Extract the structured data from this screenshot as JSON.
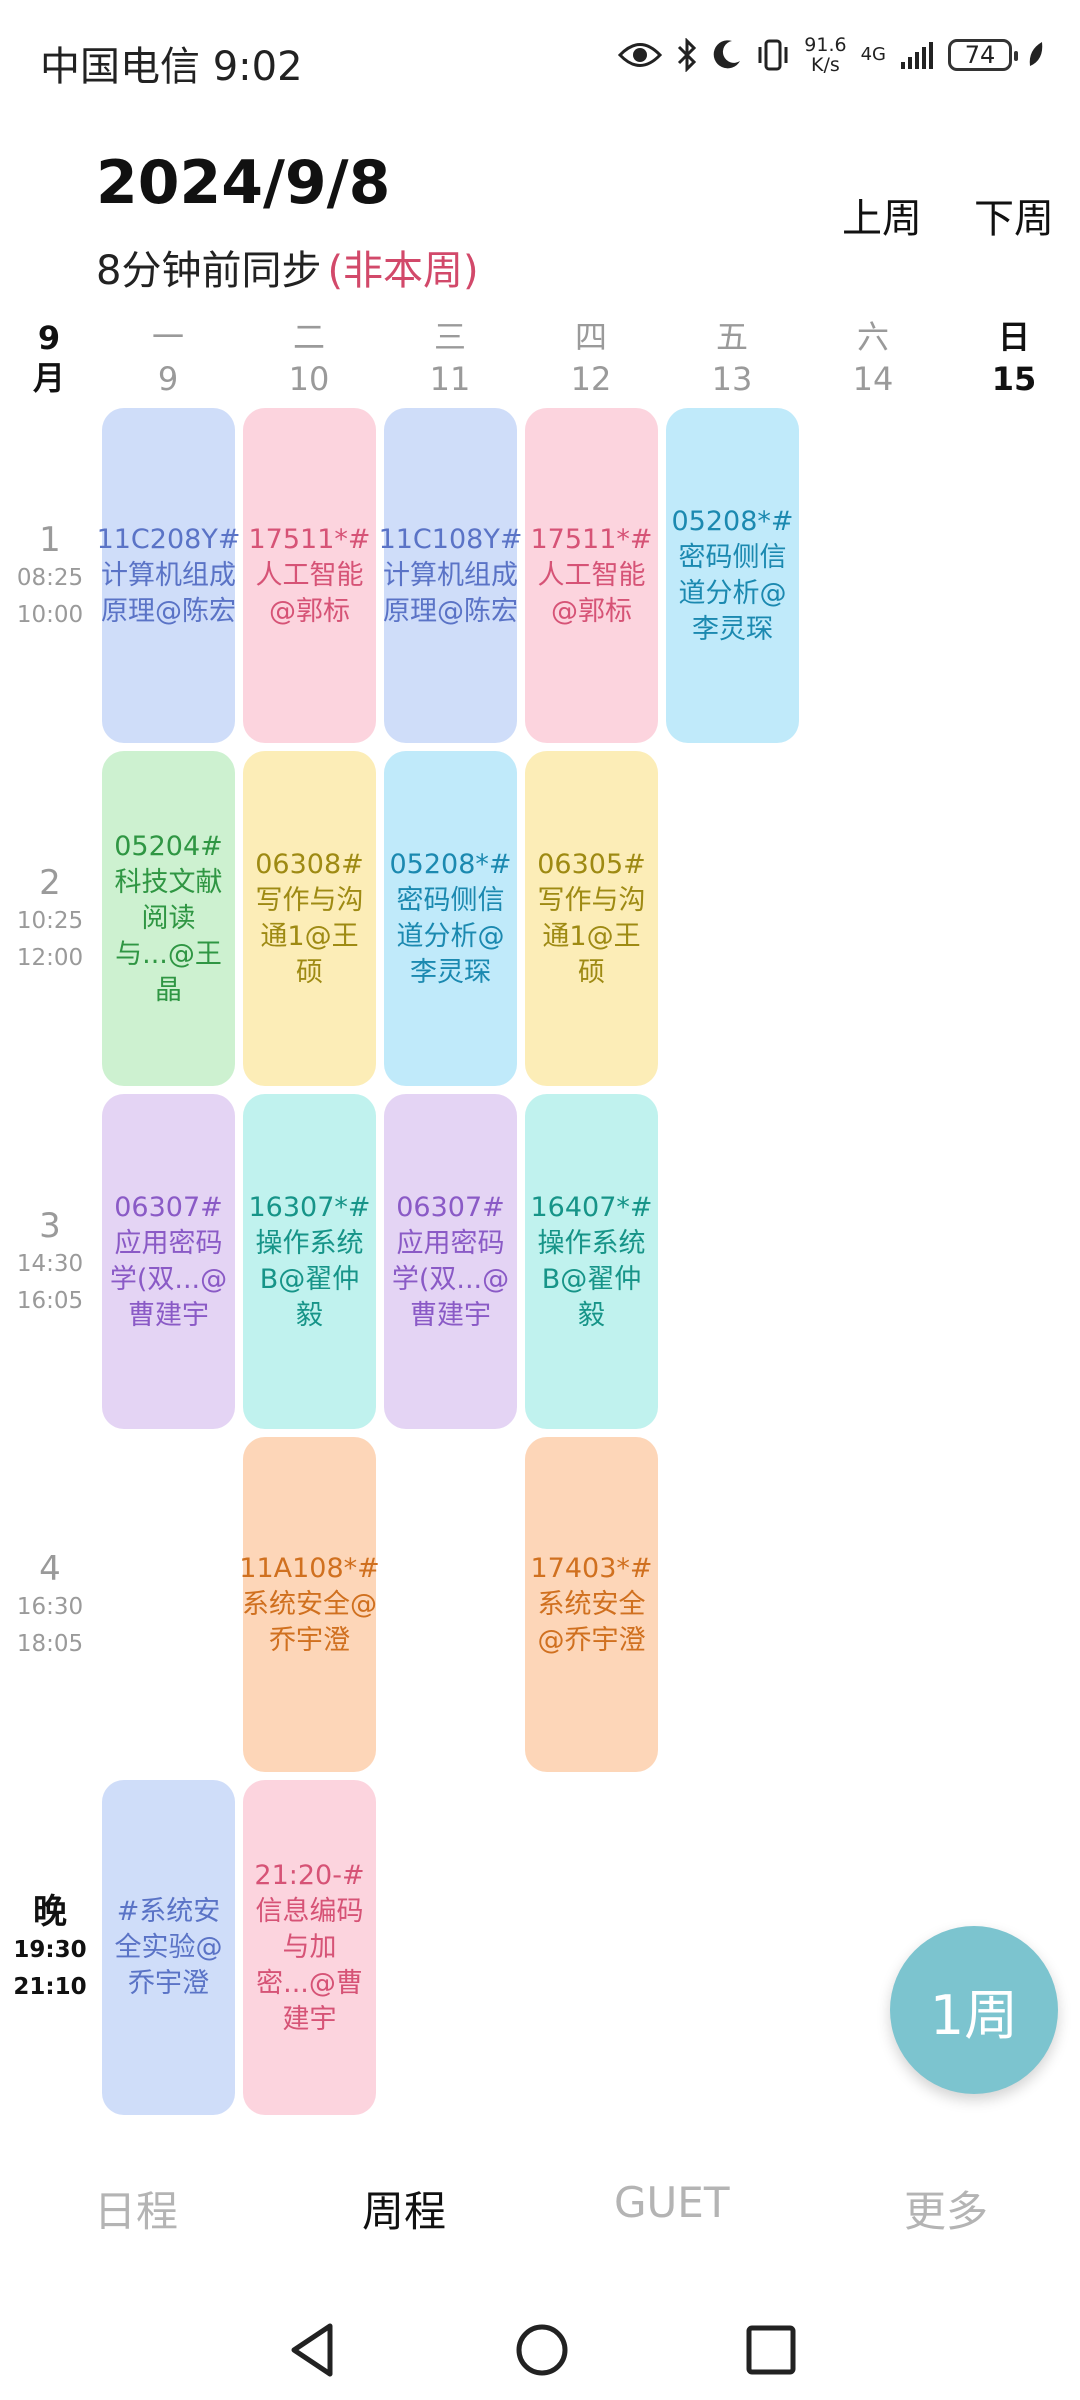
{
  "status_bar": {
    "carrier_time": "中国电信 9:02",
    "net_speed_top": "91.6",
    "net_speed_bottom": "K/s",
    "network": "4G",
    "battery": "74"
  },
  "header": {
    "date": "2024/9/8",
    "sync_text": "8分钟前同步",
    "week_note": "(非本周)",
    "prev_week": "上周",
    "next_week": "下周"
  },
  "month": {
    "num": "9",
    "unit": "月"
  },
  "days": [
    {
      "weekday": "一",
      "date": "9"
    },
    {
      "weekday": "二",
      "date": "10"
    },
    {
      "weekday": "三",
      "date": "11"
    },
    {
      "weekday": "四",
      "date": "12"
    },
    {
      "weekday": "五",
      "date": "13"
    },
    {
      "weekday": "六",
      "date": "14"
    },
    {
      "weekday": "日",
      "date": "15"
    }
  ],
  "slots": [
    {
      "label": "1",
      "start": "08:25",
      "end": "10:00"
    },
    {
      "label": "2",
      "start": "10:25",
      "end": "12:00"
    },
    {
      "label": "3",
      "start": "14:30",
      "end": "16:05"
    },
    {
      "label": "4",
      "start": "16:30",
      "end": "18:05"
    },
    {
      "label": "晚",
      "start": "19:30",
      "end": "21:10"
    }
  ],
  "courses": [
    {
      "day": 1,
      "slot": 1,
      "text": "11C208Y#计算机组成原理@陈宏",
      "color": "blue"
    },
    {
      "day": 2,
      "slot": 1,
      "text": "17511*#人工智能@郭标",
      "color": "pink"
    },
    {
      "day": 3,
      "slot": 1,
      "text": "11C108Y#计算机组成原理@陈宏",
      "color": "blue"
    },
    {
      "day": 4,
      "slot": 1,
      "text": "17511*#人工智能@郭标",
      "color": "pink"
    },
    {
      "day": 5,
      "slot": 1,
      "text": "05208*#密码侧信道分析@李灵琛",
      "color": "cyan"
    },
    {
      "day": 1,
      "slot": 2,
      "text": "05204#科技文献阅读与...@王晶",
      "color": "green"
    },
    {
      "day": 2,
      "slot": 2,
      "text": "06308#写作与沟通1@王硕",
      "color": "yellow"
    },
    {
      "day": 3,
      "slot": 2,
      "text": "05208*#密码侧信道分析@李灵琛",
      "color": "cyan"
    },
    {
      "day": 4,
      "slot": 2,
      "text": "06305#写作与沟通1@王硕",
      "color": "yellow"
    },
    {
      "day": 1,
      "slot": 3,
      "text": "06307#应用密码学(双...@曹建宇",
      "color": "purple"
    },
    {
      "day": 2,
      "slot": 3,
      "text": "16307*#操作系统B@翟仲毅",
      "color": "teal"
    },
    {
      "day": 3,
      "slot": 3,
      "text": "06307#应用密码学(双...@曹建宇",
      "color": "purple"
    },
    {
      "day": 4,
      "slot": 3,
      "text": "16407*#操作系统B@翟仲毅",
      "color": "teal"
    },
    {
      "day": 2,
      "slot": 4,
      "text": "11A108*#系统安全@乔宇澄",
      "color": "orange"
    },
    {
      "day": 4,
      "slot": 4,
      "text": "17403*#系统安全@乔宇澄",
      "color": "orange"
    },
    {
      "day": 1,
      "slot": 5,
      "text": "#系统安全实验@乔宇澄",
      "color": "blue"
    },
    {
      "day": 2,
      "slot": 5,
      "text": "21:20-#信息编码与加密...@曹建宇",
      "color": "pink"
    }
  ],
  "fab": {
    "label": "1周"
  },
  "bottom_nav": [
    "日程",
    "周程",
    "GUET",
    "更多"
  ]
}
